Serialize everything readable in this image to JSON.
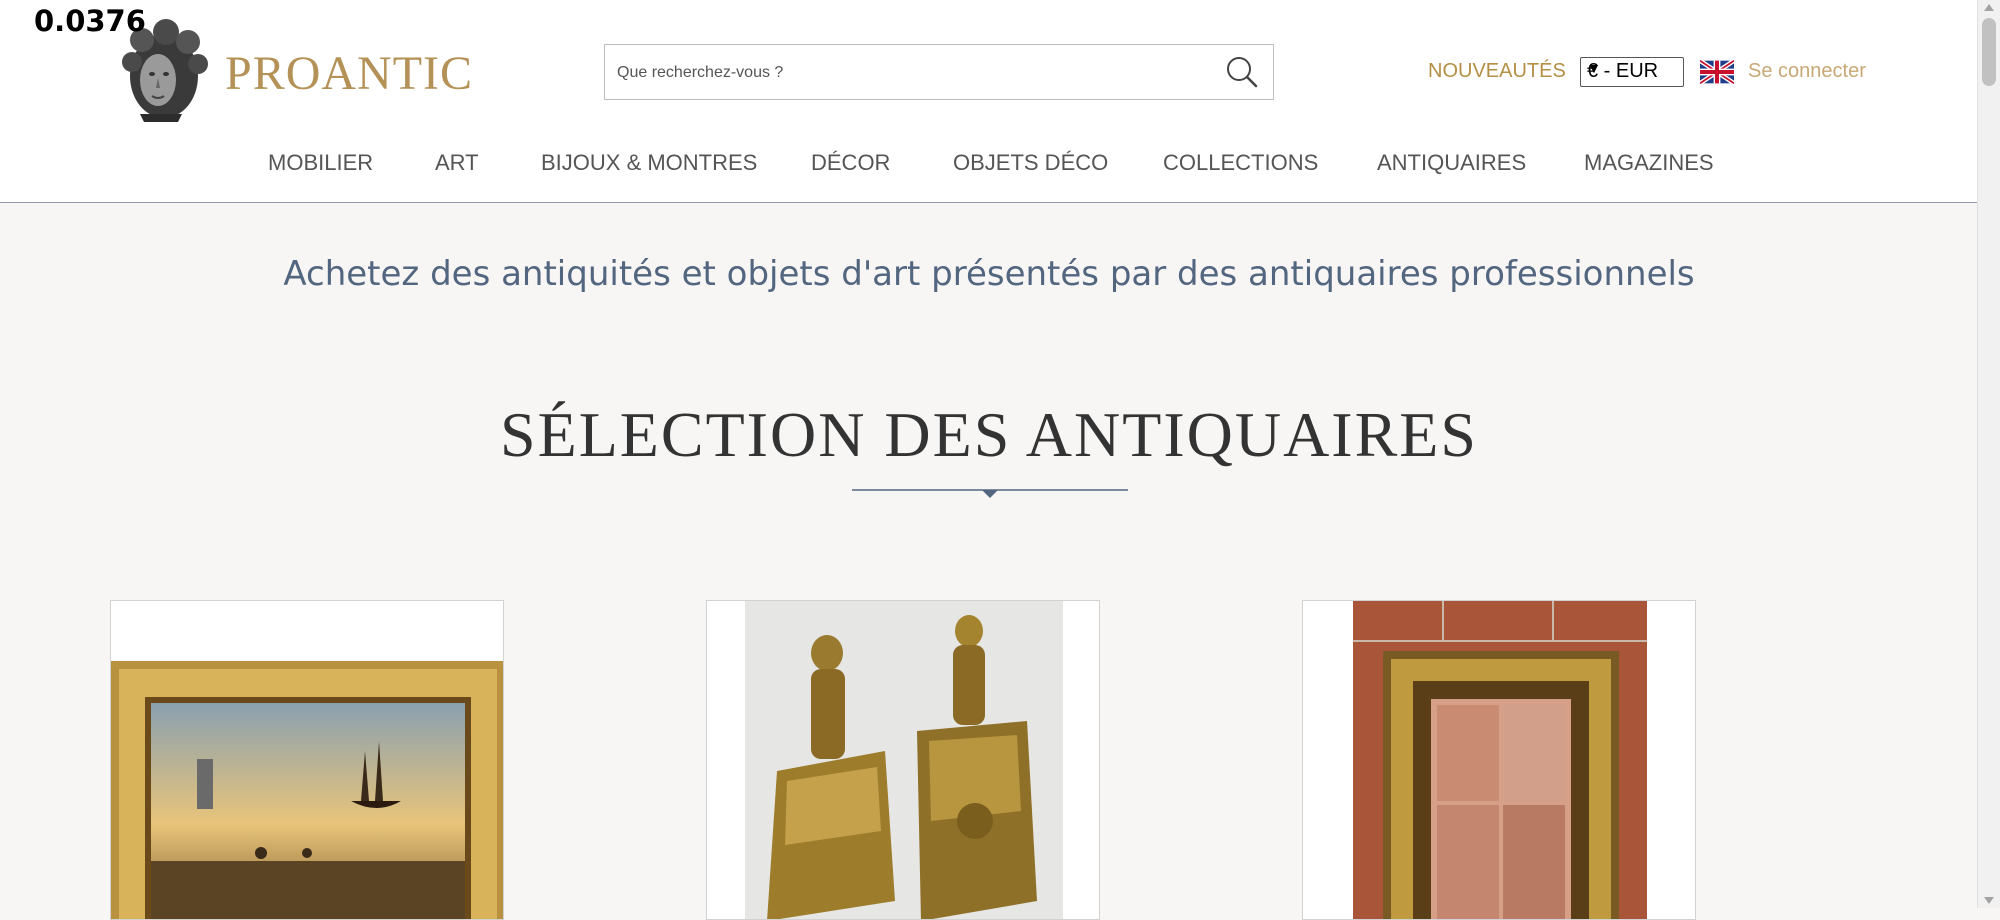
{
  "overlay": {
    "value": "0.0376"
  },
  "header": {
    "brand": "PROANTIC",
    "search": {
      "placeholder": "Que recherchez-vous ?",
      "value": ""
    },
    "nouveautes_label": "NOUVEAUTÉS",
    "currency": {
      "selected": "€ - EUR"
    },
    "language_icon": "uk-flag-icon",
    "login_label": "Se connecter"
  },
  "nav": {
    "items": [
      {
        "label": "MOBILIER"
      },
      {
        "label": "ART"
      },
      {
        "label": "BIJOUX & MONTRES"
      },
      {
        "label": "DÉCOR"
      },
      {
        "label": "OBJETS DÉCO"
      },
      {
        "label": "COLLECTIONS"
      },
      {
        "label": "ANTIQUAIRES"
      },
      {
        "label": "MAGAZINES"
      }
    ]
  },
  "main": {
    "tagline": "Achetez des antiquités et objets d'art présentés par des antiquaires professionnels",
    "section_title": "SÉLECTION DES ANTIQUAIRES",
    "products": [
      {
        "image": "seascape-painting-gilt-frame"
      },
      {
        "image": "gilt-bronze-cherub-chenets"
      },
      {
        "image": "carved-gilt-wood-frame"
      }
    ]
  },
  "colors": {
    "brand_gold": "#b49156",
    "link_gold": "#b48f45",
    "tagline_blue": "#52667f",
    "background": "#f7f6f5"
  }
}
